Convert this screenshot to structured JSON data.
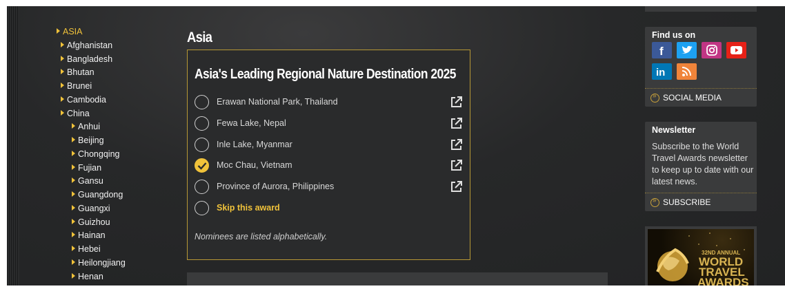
{
  "sidebar": {
    "items": [
      {
        "label": "ASIA",
        "level": 0,
        "active": true
      },
      {
        "label": "Afghanistan",
        "level": 1
      },
      {
        "label": "Bangladesh",
        "level": 1
      },
      {
        "label": "Bhutan",
        "level": 1
      },
      {
        "label": "Brunei",
        "level": 1
      },
      {
        "label": "Cambodia",
        "level": 1
      },
      {
        "label": "China",
        "level": 1
      },
      {
        "label": "Anhui",
        "level": 2
      },
      {
        "label": "Beijing",
        "level": 2
      },
      {
        "label": "Chongqing",
        "level": 2
      },
      {
        "label": "Fujian",
        "level": 2
      },
      {
        "label": "Gansu",
        "level": 2
      },
      {
        "label": "Guangdong",
        "level": 2
      },
      {
        "label": "Guangxi",
        "level": 2
      },
      {
        "label": "Guizhou",
        "level": 2
      },
      {
        "label": "Hainan",
        "level": 2
      },
      {
        "label": "Hebei",
        "level": 2
      },
      {
        "label": "Heilongjiang",
        "level": 2
      },
      {
        "label": "Henan",
        "level": 2
      }
    ]
  },
  "main": {
    "section_title": "Asia",
    "award": {
      "title": "Asia's Leading Regional Nature Destination 2025",
      "nominees": [
        {
          "label": "Erawan National Park, Thailand",
          "selected": false
        },
        {
          "label": "Fewa Lake, Nepal",
          "selected": false
        },
        {
          "label": "Inle Lake, Myanmar",
          "selected": false
        },
        {
          "label": "Moc Chau, Vietnam",
          "selected": true
        },
        {
          "label": "Province of Aurora, Philippines",
          "selected": false
        }
      ],
      "skip_label": "Skip this award",
      "note": "Nominees are listed alphabetically."
    }
  },
  "right": {
    "find_us": {
      "title": "Find us on",
      "networks": [
        {
          "icon": "facebook-icon",
          "color": "#3b5998"
        },
        {
          "icon": "twitter-icon",
          "color": "#1da1f2"
        },
        {
          "icon": "instagram-icon",
          "color": "#c13584"
        },
        {
          "icon": "youtube-icon",
          "color": "#e62117"
        },
        {
          "icon": "linkedin-icon",
          "color": "#0077b5"
        },
        {
          "icon": "rss-icon",
          "color": "#f0843a"
        }
      ],
      "link": "SOCIAL MEDIA"
    },
    "newsletter": {
      "title": "Newsletter",
      "text": "Subscribe to the World Travel Awards newsletter to keep up to date with our latest news.",
      "link": "SUBSCRIBE"
    },
    "banner": {
      "line1": "32ND ANNUAL",
      "line2": "WORLD",
      "line3": "TRAVEL",
      "line4": "AWARDS"
    }
  },
  "colors": {
    "accent": "#f0c23a",
    "background": "#272829",
    "panel": "#3a3b3c"
  }
}
